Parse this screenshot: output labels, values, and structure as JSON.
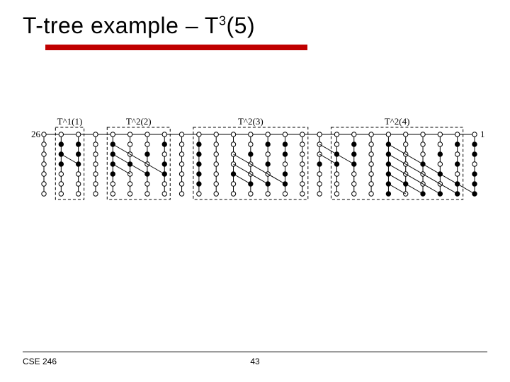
{
  "title": {
    "pre": "T-tree example – T",
    "sup": "3",
    "post": "(5)"
  },
  "footer": {
    "course": "CSE 246",
    "pageno": "43"
  },
  "diagram": {
    "cols": 26,
    "rows": 7,
    "leftLabel": "26",
    "rightLabel": "1",
    "groups": [
      {
        "label": "T^2(4)",
        "startCol": 2,
        "endCol": 9
      },
      {
        "label": "T^2(3)",
        "startCol": 11,
        "endCol": 17
      },
      {
        "label": "T^2(2)",
        "startCol": 19,
        "endCol": 22
      },
      {
        "label": "T^1(1)",
        "startCol": 24,
        "endCol": 25
      }
    ],
    "filled": [
      [
        1,
        1
      ],
      [
        1,
        2
      ],
      [
        1,
        4
      ],
      [
        1,
        5
      ],
      [
        1,
        6
      ],
      [
        2,
        1
      ],
      [
        2,
        3
      ],
      [
        2,
        5
      ],
      [
        2,
        6
      ],
      [
        3,
        2
      ],
      [
        3,
        4
      ],
      [
        3,
        6
      ],
      [
        4,
        3
      ],
      [
        4,
        6
      ],
      [
        5,
        5
      ],
      [
        6,
        1
      ],
      [
        6,
        2
      ],
      [
        6,
        3
      ],
      [
        6,
        4
      ],
      [
        6,
        5
      ],
      [
        6,
        6
      ],
      [
        8,
        1
      ],
      [
        8,
        2
      ],
      [
        8,
        3
      ],
      [
        9,
        2
      ],
      [
        9,
        3
      ],
      [
        10,
        3
      ],
      [
        12,
        1
      ],
      [
        12,
        2
      ],
      [
        12,
        4
      ],
      [
        12,
        5
      ],
      [
        13,
        1
      ],
      [
        13,
        3
      ],
      [
        13,
        5
      ],
      [
        14,
        2
      ],
      [
        14,
        5
      ],
      [
        15,
        4
      ],
      [
        17,
        1
      ],
      [
        17,
        2
      ],
      [
        17,
        3
      ],
      [
        17,
        4
      ],
      [
        17,
        5
      ],
      [
        19,
        1
      ],
      [
        19,
        3
      ],
      [
        19,
        4
      ],
      [
        20,
        2
      ],
      [
        20,
        4
      ],
      [
        21,
        3
      ],
      [
        22,
        1
      ],
      [
        22,
        2
      ],
      [
        22,
        3
      ],
      [
        22,
        4
      ],
      [
        24,
        1
      ],
      [
        24,
        2
      ],
      [
        24,
        3
      ],
      [
        25,
        1
      ],
      [
        25,
        2
      ],
      [
        25,
        3
      ]
    ],
    "diagonals": [
      [
        1,
        6,
        6,
        1
      ],
      [
        2,
        6,
        6,
        2
      ],
      [
        3,
        6,
        6,
        3
      ],
      [
        4,
        6,
        6,
        4
      ],
      [
        5,
        6,
        6,
        5
      ],
      [
        8,
        3,
        10,
        1
      ],
      [
        9,
        3,
        10,
        2
      ],
      [
        12,
        5,
        15,
        2
      ],
      [
        13,
        5,
        15,
        3
      ],
      [
        14,
        5,
        15,
        4
      ],
      [
        19,
        4,
        22,
        1
      ],
      [
        20,
        4,
        22,
        2
      ],
      [
        21,
        4,
        22,
        3
      ],
      [
        24,
        3,
        25,
        2
      ]
    ]
  }
}
